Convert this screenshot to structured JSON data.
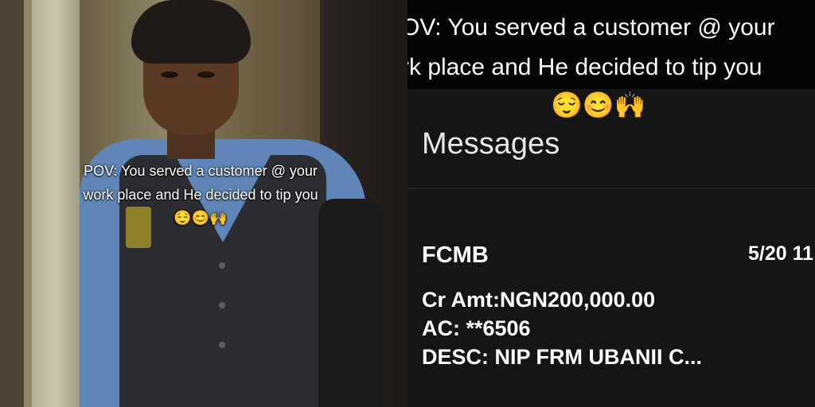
{
  "left_panel": {
    "caption_line1": "POV: You served a customer @ your",
    "caption_line2": "work place and He decided to tip you",
    "caption_emojis": "😌😊🙌"
  },
  "right_panel": {
    "caption_line1": "OV: You served a customer @ your",
    "caption_line2": "rk place and He decided to tip you",
    "caption_emojis": "😌😊🙌",
    "messages_title": "Messages",
    "message": {
      "sender": "FCMB",
      "date": "5/20 11",
      "amount_line": "Cr Amt:NGN200,000.00",
      "account_line": "AC: **6506",
      "desc_line": "DESC: NIP FRM UBANII C..."
    }
  },
  "colors": {
    "dark_background": "#151516",
    "caption_text": "#ffffff",
    "shirt_blue": "#5f86b7",
    "vest_dark": "#2b2d30"
  }
}
